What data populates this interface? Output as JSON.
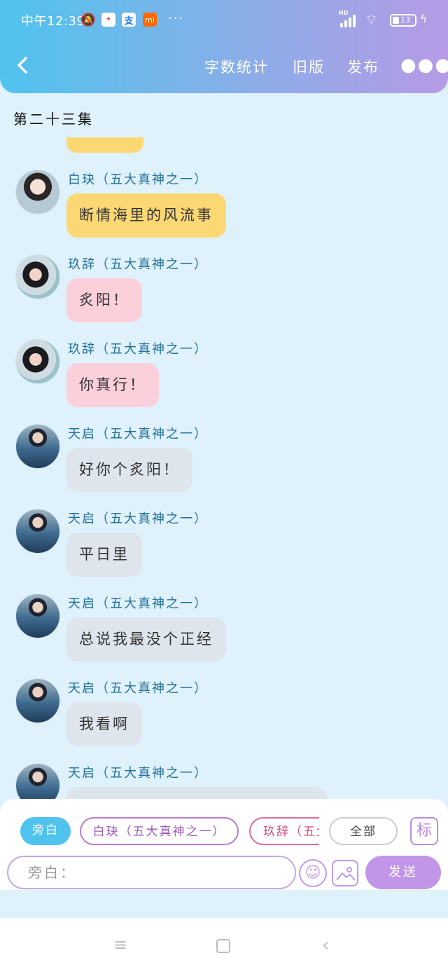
{
  "status_bar": {
    "time": "中午12:39",
    "battery": "13",
    "network": "HD"
  },
  "nav": {
    "back_icon": "chevron-left-icon",
    "word_count": "字数统计",
    "old_version": "旧版",
    "publish": "发布",
    "more": "●●●"
  },
  "episode": {
    "title": "第二十三集"
  },
  "messages": [
    {
      "speaker": "白玦（五大真神之一）",
      "text": "断情海里的风流事",
      "avatar": "baijue",
      "color": "#fcd874"
    },
    {
      "speaker": "玖辞（五大真神之一）",
      "text": "炙阳！",
      "avatar": "jiuci",
      "color": "#fcd0db"
    },
    {
      "speaker": "玖辞（五大真神之一）",
      "text": "你真行！",
      "avatar": "jiuci",
      "color": "#fcd0db"
    },
    {
      "speaker": "天启（五大真神之一）",
      "text": "好你个炙阳！",
      "avatar": "tianqi",
      "color": "#dfe5ec"
    },
    {
      "speaker": "天启（五大真神之一）",
      "text": "平日里",
      "avatar": "tianqi",
      "color": "#dfe5ec"
    },
    {
      "speaker": "天启（五大真神之一）",
      "text": "总说我最没个正经",
      "avatar": "tianqi",
      "color": "#dfe5ec"
    },
    {
      "speaker": "天启（五大真神之一）",
      "text": "我看啊",
      "avatar": "tianqi",
      "color": "#dfe5ec"
    },
    {
      "speaker": "天启（五大真神之一）",
      "text": "",
      "avatar": "tianqi",
      "color": "#dfe5ec"
    }
  ],
  "panel": {
    "chips": {
      "narration": "旁白",
      "baijue": "白玦（五大真神之一）",
      "jiuci": "玖辞（五大真神之一）",
      "all": "全部",
      "mark": "标"
    },
    "input_placeholder": "旁白：",
    "send": "发送"
  },
  "colors": {
    "header_start": "#4fc3ee",
    "header_end": "#b69ae6",
    "accent_purple": "#c196e8",
    "narration_blue": "#4fc3ee"
  }
}
